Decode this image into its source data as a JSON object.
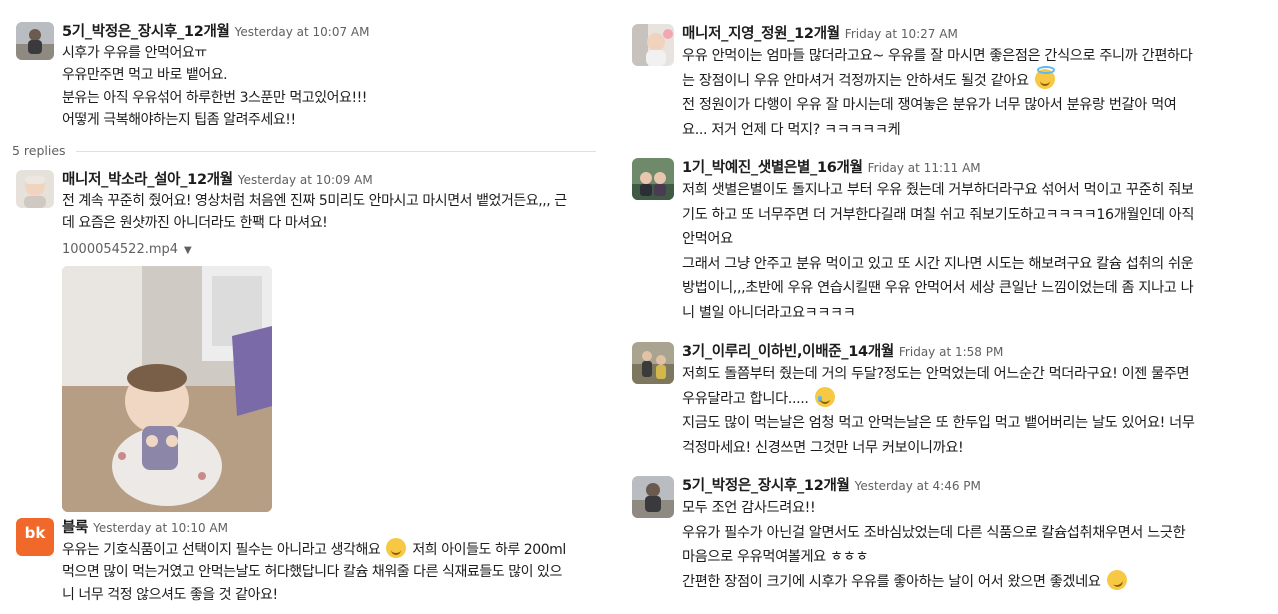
{
  "thread": {
    "parent": {
      "author": "5기_박정은_장시후_12개월",
      "time": "Yesterday at 10:07 AM",
      "lines": [
        "시후가 우유를 안먹어요ㅠ",
        "우유만주면 먹고 바로 뱉어요.",
        "분유는 아직 우유섞어 하루한번 3스푼만 먹고있어요!!!",
        "어떻게 극복해야하는지 팁좀 알려주세요!!"
      ]
    },
    "replies_label": "5 replies",
    "reply1": {
      "author": "매니저_박소라_설아_12개월",
      "time": "Yesterday at 10:09 AM",
      "lines": [
        "전 계속 꾸준히 줬어요! 영상처럼 처음엔 진짜 5미리도 안마시고 마시면서 뱉었거든요,,, 근",
        "데 요즘은 원샷까진 아니더라도 한팩 다 마셔요!"
      ],
      "file_name": "1000054522.mp4",
      "file_caret": "▼"
    },
    "reply2": {
      "author": "블룩",
      "time": "Yesterday at 10:10 AM",
      "avatar_text": "bk",
      "lines": [
        "우유는 기호식품이고 선택이지 필수는 아니라고 생각해요",
        " 저희 아이들도 하루 200ml",
        "먹으면 많이 먹는거였고 안먹는날도 허다했답니다 칼슘 채워줄 다른 식재료들도 많이 있으",
        "니 너무 걱정 않으셔도 좋을 것 같아요!"
      ]
    },
    "reply3": {
      "author": "매니저_지영_정원_12개월",
      "time": "Friday at 10:27 AM",
      "lines": [
        "우유 안먹이는 엄마들 많더라고요~ 우유를 잘 마시면 좋은점은 간식으로 주니까 간편하다",
        "는 장점이니 우유 안마셔거 걱정까지는 안하셔도 될것 같아요",
        "전 정원이가 다행이 우유 잘 마시는데 쟁여놓은 분유가 너무 많아서 분유랑 번갈아 먹여",
        "요... 저거 언제 다 먹지? ㅋㅋㅋㅋㅋ케"
      ]
    },
    "reply4": {
      "author": "1기_박예진_샛별은별_16개월",
      "time": "Friday at 11:11 AM",
      "lines": [
        "저희 샛별은별이도 돌지나고 부터 우유 줬는데 거부하더라구요 섞어서 먹이고 꾸준히 줘보",
        "기도 하고 또 너무주면 더 거부한다길래 며칠 쉬고 줘보기도하고ㅋㅋㅋㅋ16개월인데 아직",
        "안먹어요",
        "그래서 그냥 안주고 분유 먹이고 있고 또 시간 지나면 시도는 해보려구요 칼슘 섭취의 쉬운",
        "방법이니,,,초반에 우유 연습시킬땐 우유 안먹어서 세상 큰일난 느낌이었는데 좀 지나고 나",
        "니 별일 아니더라고요ㅋㅋㅋㅋ"
      ]
    },
    "reply5": {
      "author": "3기_이루리_이하빈,이배준_14개월",
      "time": "Friday at 1:58 PM",
      "lines": [
        "저희도 돌쯤부터 줬는데 거의 두달?정도는 안먹었는데 어느순간 먹더라구요! 이젠 물주면",
        "우유달라고 합니다.....",
        "지금도 많이 먹는날은 엄청 먹고 안먹는날은 또 한두입 먹고 뱉어버리는 날도 있어요! 너무",
        "걱정마세요! 신경쓰면 그것만 너무 커보이니까요!"
      ]
    },
    "reply6": {
      "author": "5기_박정은_장시후_12개월",
      "time": "Yesterday at 4:46 PM",
      "lines": [
        "모두 조언 감사드려요!!",
        "우유가 필수가 아닌걸 알면서도 조바심났었는데 다른 식품으로 칼슘섭취채우면서 느긋한",
        "마음으로 우유먹여볼게요 ㅎㅎㅎ",
        "간편한 장점이 크기에 시후가 우유를 좋아하는 날이 어서 왔으면 좋겠네요"
      ]
    }
  },
  "emojis": {
    "smile": "slightly-smiling-face",
    "halo": "smiling-face-with-halo",
    "cry": "crying-face",
    "rofl": "rolling-on-floor-laughing"
  },
  "colors": {
    "text": "#1d1c1d",
    "muted": "#616061",
    "blurk_brand": "#f0692a"
  }
}
